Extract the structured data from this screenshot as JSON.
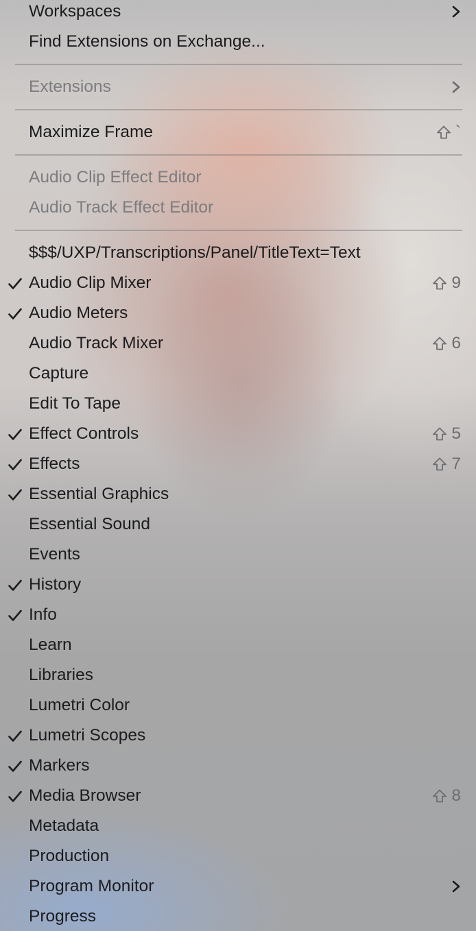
{
  "menu": {
    "items": [
      {
        "label": "Workspaces",
        "submenu": true
      },
      {
        "label": "Find Extensions on Exchange..."
      },
      {
        "separator": true
      },
      {
        "label": "Extensions",
        "disabled": true,
        "submenu": true
      },
      {
        "separator": true
      },
      {
        "label": "Maximize Frame",
        "shortcut": "`"
      },
      {
        "separator": true
      },
      {
        "label": "Audio Clip Effect Editor",
        "disabled": true
      },
      {
        "label": "Audio Track Effect Editor",
        "disabled": true
      },
      {
        "separator": true
      },
      {
        "label": "$$$/UXP/Transcriptions/Panel/TitleText=Text"
      },
      {
        "label": "Audio Clip Mixer",
        "checked": true,
        "shortcut": "9"
      },
      {
        "label": "Audio Meters",
        "checked": true
      },
      {
        "label": "Audio Track Mixer",
        "shortcut": "6"
      },
      {
        "label": "Capture"
      },
      {
        "label": "Edit To Tape"
      },
      {
        "label": "Effect Controls",
        "checked": true,
        "shortcut": "5"
      },
      {
        "label": "Effects",
        "checked": true,
        "shortcut": "7"
      },
      {
        "label": "Essential Graphics",
        "checked": true
      },
      {
        "label": "Essential Sound"
      },
      {
        "label": "Events"
      },
      {
        "label": "History",
        "checked": true
      },
      {
        "label": "Info",
        "checked": true
      },
      {
        "label": "Learn"
      },
      {
        "label": "Libraries"
      },
      {
        "label": "Lumetri Color"
      },
      {
        "label": "Lumetri Scopes",
        "checked": true
      },
      {
        "label": "Markers",
        "checked": true
      },
      {
        "label": "Media Browser",
        "checked": true,
        "shortcut": "8"
      },
      {
        "label": "Metadata"
      },
      {
        "label": "Production"
      },
      {
        "label": "Program Monitor",
        "submenu": true
      },
      {
        "label": "Progress"
      }
    ]
  }
}
